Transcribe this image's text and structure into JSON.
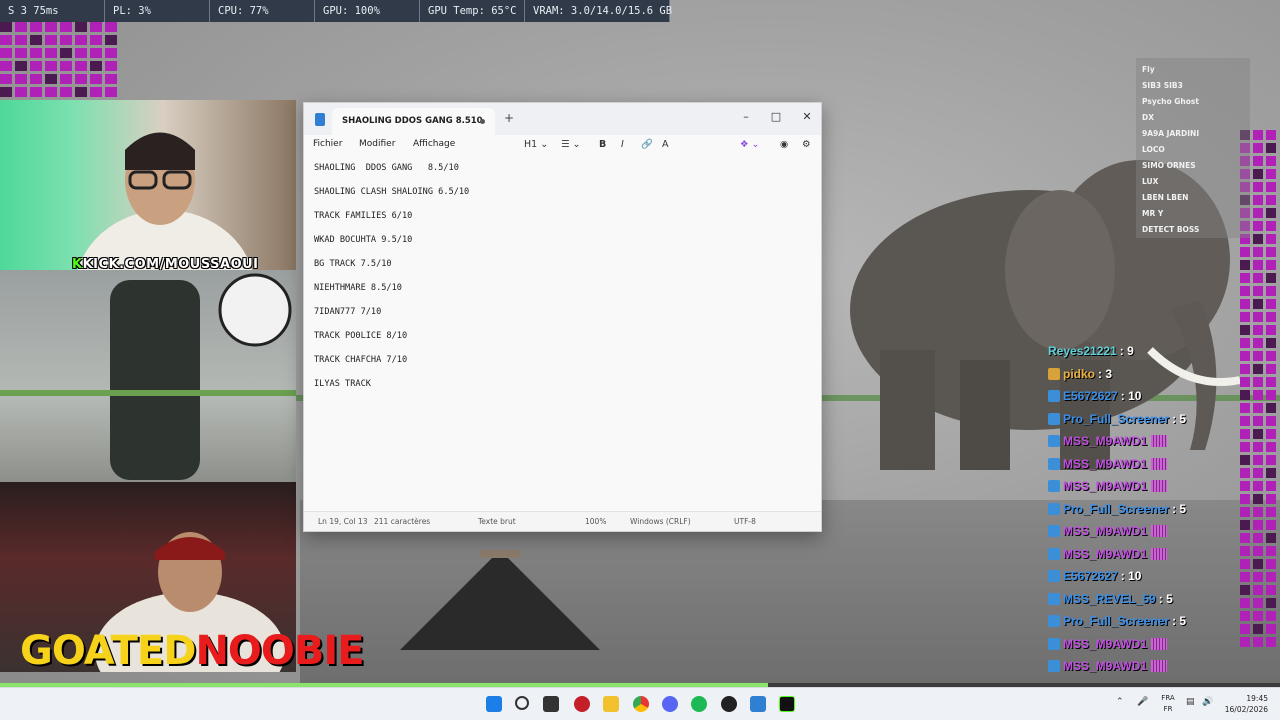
{
  "overlay": {
    "stats": [
      "S 3  75ms",
      "PL: 3%",
      "CPU: 77%",
      "GPU: 100%",
      "GPU Temp: 65°C",
      "VRAM: 3.0/14.0/15.6 GB"
    ]
  },
  "streams": {
    "kick_handle": "KICK.COM/MOUSSAOUI",
    "kick_k": "K",
    "goated_a": "GOATED",
    "goated_b": "NOOBIE"
  },
  "notepad": {
    "tab_title": "SHAOLING  DDOS GANG  8.510",
    "menu": [
      "Fichier",
      "Modifier",
      "Affichage"
    ],
    "heading_label": "H1",
    "lines": [
      "SHAOLING  DDOS GANG   8.5/10",
      "SHAOLING CLASH SHALOING 6.5/10",
      "TRACK FAMILIES 6/10",
      "WKAD BOCUHTA 9.5/10",
      "BG TRACK 7.5/10",
      "NIEHTHMARE 8.5/10",
      "7IDAN777 7/10",
      "TRACK PO0LICE 8/10",
      "TRACK CHAFCHA 7/10",
      "ILYAS TRACK"
    ],
    "status": {
      "position": "Ln 19, Col 13",
      "chars": "211 caractères",
      "format": "Texte brut",
      "zoom": "100%",
      "eol": "Windows (CRLF)",
      "encoding": "UTF-8"
    }
  },
  "viewers": [
    "Fly",
    "SIB3 SIB3",
    "Psycho Ghost",
    "DX",
    "9A9A JARDINI",
    "LOCO",
    "SIMO ORNES",
    "LUX",
    "LBEN LBEN",
    "MR Y",
    "DETECT BOSS"
  ],
  "chat": [
    {
      "name": "Reyes21221",
      "value": "9",
      "color": "#5fd0d8",
      "icon": "none"
    },
    {
      "name": "pidko",
      "value": "3",
      "color": "#e8b040",
      "icon": "gold"
    },
    {
      "name": "E5672627",
      "value": "10",
      "color": "#3a8fe8",
      "icon": "blue"
    },
    {
      "name": "Pro_Full_Screener",
      "value": "5",
      "color": "#3a8fe8",
      "icon": "blue"
    },
    {
      "name": "MSS_M9AWD1",
      "value": "",
      "color": "#c050e0",
      "icon": "blue"
    },
    {
      "name": "MSS_M9AWD1",
      "value": "",
      "color": "#c050e0",
      "icon": "blue"
    },
    {
      "name": "MSS_M9AWD1",
      "value": "",
      "color": "#c050e0",
      "icon": "blue"
    },
    {
      "name": "Pro_Full_Screener",
      "value": "5",
      "color": "#3a8fe8",
      "icon": "blue"
    },
    {
      "name": "MSS_M9AWD1",
      "value": "",
      "color": "#c050e0",
      "icon": "blue"
    },
    {
      "name": "MSS_M9AWD1",
      "value": "",
      "color": "#c050e0",
      "icon": "blue"
    },
    {
      "name": "E5672627",
      "value": "10",
      "color": "#3a8fe8",
      "icon": "blue"
    },
    {
      "name": "MSS_REVEL_59",
      "value": "5",
      "color": "#3a8fe8",
      "icon": "blue"
    },
    {
      "name": "Pro_Full_Screener",
      "value": "5",
      "color": "#3a8fe8",
      "icon": "blue"
    },
    {
      "name": "MSS_M9AWD1",
      "value": "",
      "color": "#c050e0",
      "icon": "blue"
    },
    {
      "name": "MSS_M9AWD1",
      "value": "",
      "color": "#c050e0",
      "icon": "blue"
    },
    {
      "name": "MSS_M9AWD1",
      "value": "",
      "color": "#c050e0",
      "icon": "blue"
    }
  ],
  "taskbar": {
    "progress": 0.6,
    "lang_top": "FRA",
    "lang_bottom": "FR",
    "time": "19:45",
    "date": "16/02/2026"
  }
}
